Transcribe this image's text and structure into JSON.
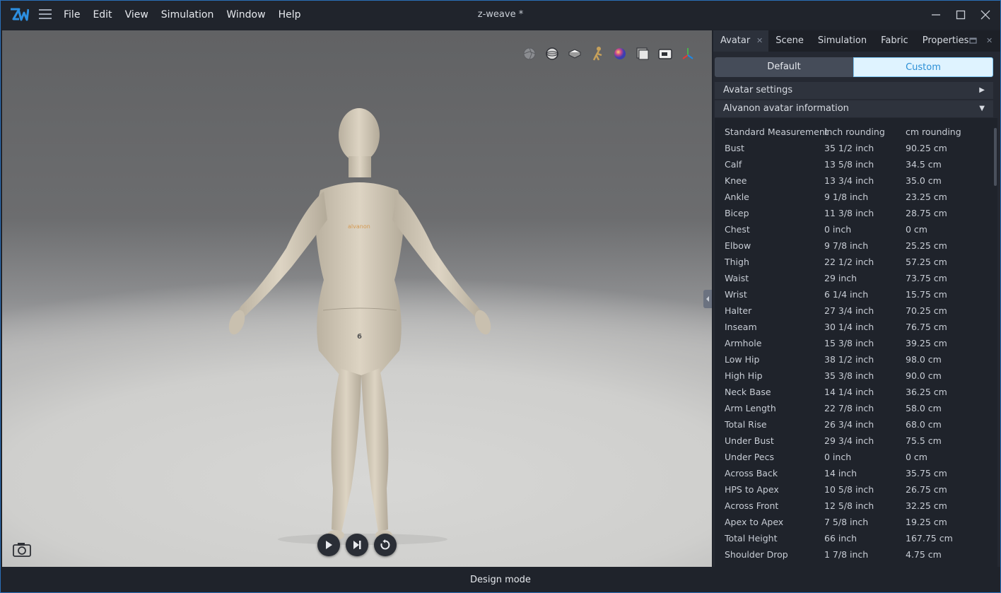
{
  "app": {
    "title": "z-weave *"
  },
  "menu": [
    "File",
    "Edit",
    "View",
    "Simulation",
    "Window",
    "Help"
  ],
  "panel": {
    "tabs": [
      "Avatar",
      "Scene",
      "Simulation",
      "Fabric",
      "Properties"
    ],
    "segments": {
      "default": "Default",
      "custom": "Custom",
      "selected": "Custom"
    },
    "sections": {
      "avatar_settings": "Avatar settings",
      "avatar_info": "Alvanon avatar information"
    },
    "table": {
      "headers": [
        "Standard Measurement",
        "inch rounding",
        "cm rounding"
      ],
      "rows": [
        [
          "Bust",
          "35 1/2 inch",
          "90.25 cm"
        ],
        [
          "Calf",
          "13 5/8 inch",
          "34.5 cm"
        ],
        [
          "Knee",
          "13 3/4 inch",
          "35.0 cm"
        ],
        [
          "Ankle",
          "9 1/8 inch",
          "23.25 cm"
        ],
        [
          "Bicep",
          "11 3/8 inch",
          "28.75 cm"
        ],
        [
          "Chest",
          "0 inch",
          "0 cm"
        ],
        [
          "Elbow",
          "9 7/8 inch",
          "25.25 cm"
        ],
        [
          "Thigh",
          "22 1/2 inch",
          "57.25 cm"
        ],
        [
          "Waist",
          "29 inch",
          "73.75 cm"
        ],
        [
          "Wrist",
          "6 1/4 inch",
          "15.75 cm"
        ],
        [
          "Halter",
          "27 3/4 inch",
          "70.25 cm"
        ],
        [
          "Inseam",
          "30 1/4 inch",
          "76.75 cm"
        ],
        [
          "Armhole",
          "15 3/8 inch",
          "39.25 cm"
        ],
        [
          "Low Hip",
          "38 1/2 inch",
          "98.0 cm"
        ],
        [
          "High Hip",
          "35 3/8 inch",
          "90.0 cm"
        ],
        [
          "Neck Base",
          "14 1/4 inch",
          "36.25 cm"
        ],
        [
          "Arm Length",
          "22 7/8 inch",
          "58.0 cm"
        ],
        [
          "Total Rise",
          "26 3/4 inch",
          "68.0 cm"
        ],
        [
          "Under Bust",
          "29 3/4 inch",
          "75.5 cm"
        ],
        [
          "Under Pecs",
          "0 inch",
          "0 cm"
        ],
        [
          "Across Back",
          "14 inch",
          "35.75 cm"
        ],
        [
          "HPS to Apex",
          "10 5/8 inch",
          "26.75 cm"
        ],
        [
          "Across Front",
          "12 5/8 inch",
          "32.25 cm"
        ],
        [
          "Apex to Apex",
          "7 5/8 inch",
          "19.25 cm"
        ],
        [
          "Total Height",
          "66 inch",
          "167.75 cm"
        ],
        [
          "Shoulder Drop",
          "1 7/8 inch",
          "4.75 cm"
        ]
      ]
    }
  },
  "viewport": {
    "toolbar_icons": [
      "aperture-icon",
      "sphere-mesh-icon",
      "box-icon",
      "avatar-pose-icon",
      "color-sphere-icon",
      "layers-icon",
      "sewing-machine-icon",
      "axis-gizmo-icon"
    ],
    "playback": [
      "play-icon",
      "step-forward-icon",
      "reset-icon"
    ],
    "avatar_logo": "alvanon",
    "avatar_size": "6"
  },
  "status": {
    "mode": "Design mode"
  },
  "colors": {
    "accent": "#2b8fd6",
    "border": "#2a6fb8",
    "panel": "#252932"
  }
}
